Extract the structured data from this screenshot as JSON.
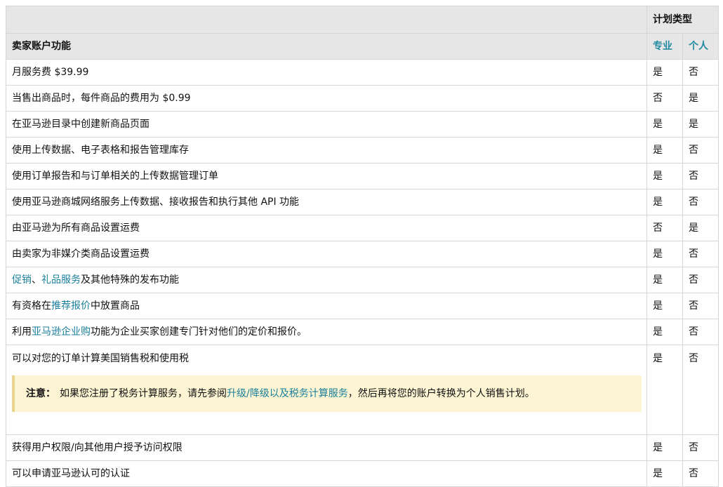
{
  "header": {
    "plan_type": "计划类型",
    "feature_col": "卖家账户功能",
    "pro": "专业",
    "individual": "个人"
  },
  "rows": [
    {
      "parts": [
        {
          "t": "月服务费 $39.99"
        }
      ],
      "pro": "是",
      "ind": "否"
    },
    {
      "parts": [
        {
          "t": "当售出商品时，每件商品的费用为 $0.99"
        }
      ],
      "pro": "否",
      "ind": "是"
    },
    {
      "parts": [
        {
          "t": "在亚马逊目录中创建新商品页面"
        }
      ],
      "pro": "是",
      "ind": "是"
    },
    {
      "parts": [
        {
          "t": "使用上传数据、电子表格和报告管理库存"
        }
      ],
      "pro": "是",
      "ind": "否"
    },
    {
      "parts": [
        {
          "t": "使用订单报告和与订单相关的上传数据管理订单"
        }
      ],
      "pro": "是",
      "ind": "否"
    },
    {
      "parts": [
        {
          "t": "使用亚马逊商城网络服务上传数据、接收报告和执行其他 API 功能"
        }
      ],
      "pro": "是",
      "ind": "否"
    },
    {
      "parts": [
        {
          "t": "由亚马逊为所有商品设置运费"
        }
      ],
      "pro": "否",
      "ind": "是"
    },
    {
      "parts": [
        {
          "t": "由卖家为非媒介类商品设置运费"
        }
      ],
      "pro": "是",
      "ind": "否"
    },
    {
      "parts": [
        {
          "t": "促销",
          "link": true
        },
        {
          "t": "、"
        },
        {
          "t": "礼品服务",
          "link": true
        },
        {
          "t": "及其他特殊的发布功能"
        }
      ],
      "pro": "是",
      "ind": "否"
    },
    {
      "parts": [
        {
          "t": "有资格在"
        },
        {
          "t": "推荐报价",
          "link": true
        },
        {
          "t": "中放置商品"
        }
      ],
      "pro": "是",
      "ind": "否"
    },
    {
      "parts": [
        {
          "t": "利用"
        },
        {
          "t": "亚马逊企业购",
          "link": true
        },
        {
          "t": "功能为企业买家创建专门针对他们的定价和报价。"
        }
      ],
      "pro": "是",
      "ind": "否"
    },
    {
      "parts": [
        {
          "t": "可以对您的订单计算美国销售税和使用税"
        }
      ],
      "pro": "是",
      "ind": "否",
      "note": {
        "label": "注意：",
        "parts": [
          {
            "t": "如果您注册了税务计算服务，请先参阅"
          },
          {
            "t": "升级/降级以及税务计算服务",
            "link": true
          },
          {
            "t": "，然后再将您的账户转换为个人销售计划。"
          }
        ]
      }
    },
    {
      "parts": [
        {
          "t": "获得用户权限/向其他用户授予访问权限"
        }
      ],
      "pro": "是",
      "ind": "否"
    },
    {
      "parts": [
        {
          "t": "可以申请亚马逊认可的认证"
        }
      ],
      "pro": "是",
      "ind": "否"
    }
  ]
}
